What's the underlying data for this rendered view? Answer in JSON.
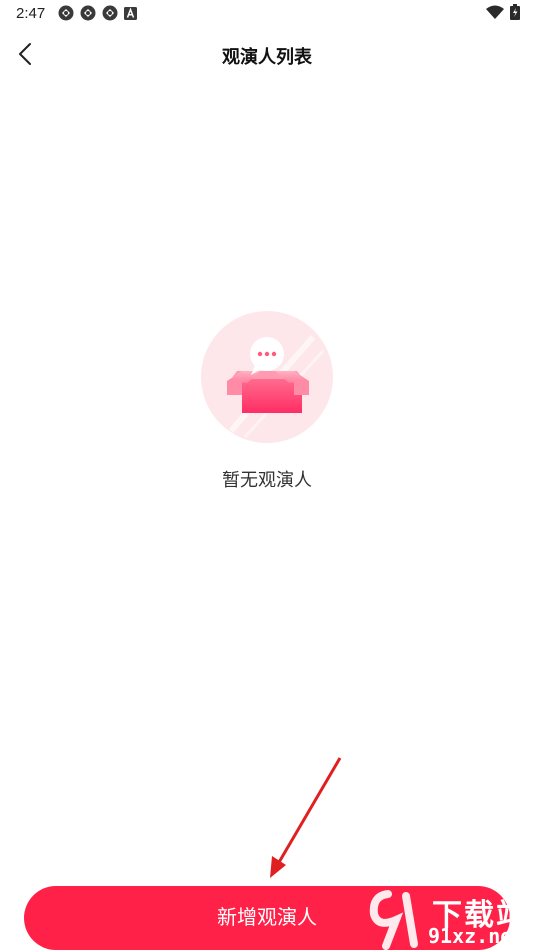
{
  "status_bar": {
    "time": "2:47",
    "left_icons": [
      "sync-icon",
      "sync-icon",
      "sync-icon",
      "a-badge-icon"
    ],
    "right_icons": [
      "wifi-icon",
      "battery-icon"
    ]
  },
  "header": {
    "back_icon": "chevron-left-icon",
    "title": "观演人列表"
  },
  "empty_state": {
    "icon": "empty-box-icon",
    "message": "暂无观演人"
  },
  "footer": {
    "add_button_label": "新增观演人"
  },
  "watermark": {
    "line1": "下载站",
    "line2": "91xz.net"
  },
  "colors": {
    "accent": "#ff2148",
    "illustration_bg": "#fde7ea",
    "box_pink": "#ff4a78"
  }
}
